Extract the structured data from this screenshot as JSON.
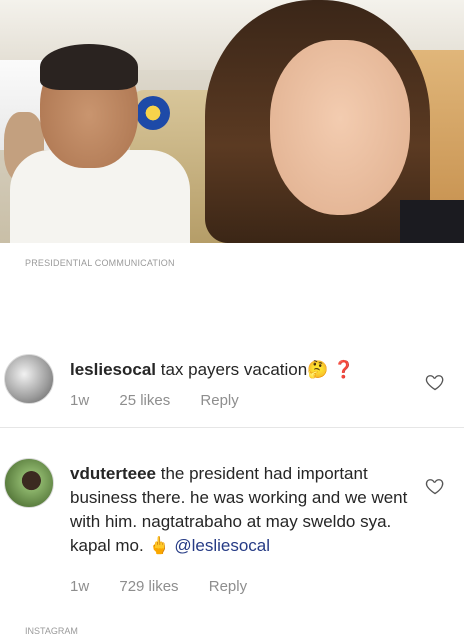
{
  "photo": {
    "alt_subject": "selfie"
  },
  "photo_credit": "PRESIDENTIAL COMMUNICATION",
  "comments": [
    {
      "username": "lesliesocal",
      "text": "tax payers vacation",
      "emoji": "🤔",
      "suffix": "❓",
      "time": "1w",
      "likes": "25 likes",
      "reply": "Reply"
    },
    {
      "username": "vduterteee",
      "text": "the president had important business there. he was working and we went with him. nagtatrabaho at may sweldo sya. kapal mo.",
      "emoji": "🖕",
      "mention": "@lesliesocal",
      "time": "1w",
      "likes": "729 likes",
      "reply": "Reply"
    }
  ],
  "source_credit": "INSTAGRAM",
  "colors": {
    "mention": "#263b85",
    "muted": "#8e8e8e",
    "text": "#262626"
  }
}
